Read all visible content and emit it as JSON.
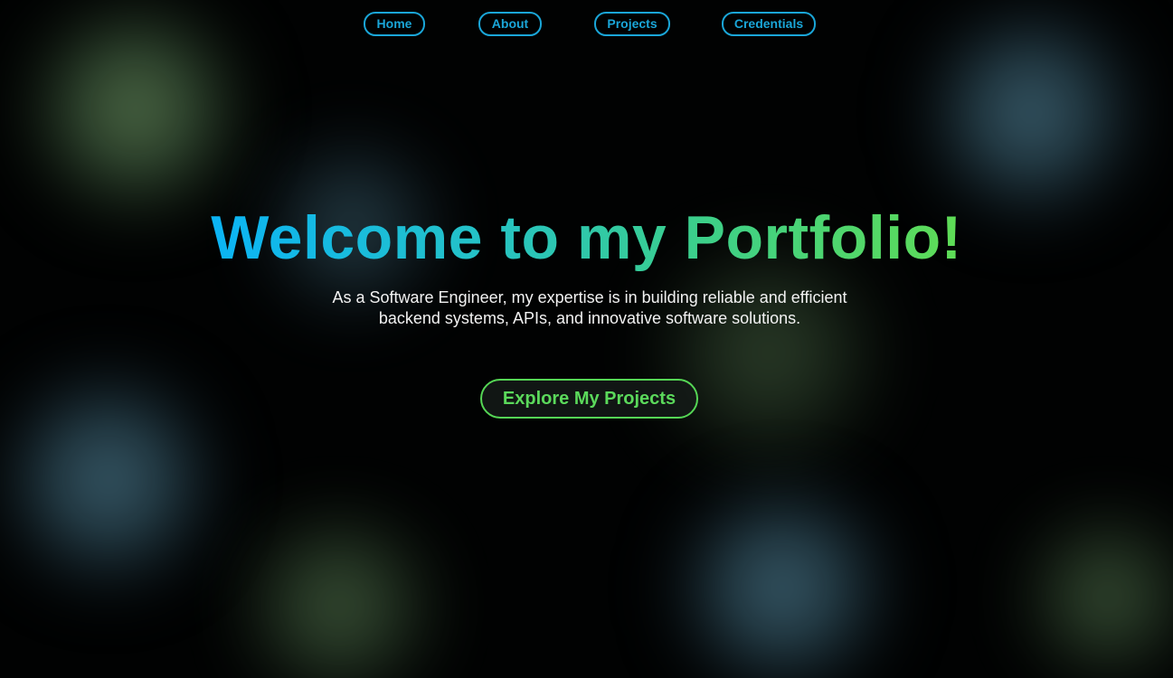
{
  "nav": {
    "items": [
      {
        "label": "Home"
      },
      {
        "label": "About"
      },
      {
        "label": "Projects"
      },
      {
        "label": "Credentials"
      }
    ]
  },
  "hero": {
    "title": "Welcome to my Portfolio!",
    "subtitle_line1": "As a Software Engineer, my expertise is in building reliable and efficient",
    "subtitle_line2": "backend systems, APIs, and innovative software solutions.",
    "cta_label": "Explore My Projects"
  },
  "colors": {
    "accent_blue": "#1aa6d8",
    "accent_green": "#55d655",
    "title_gradient_start": "#0bb4f5",
    "title_gradient_end": "#5fdc55",
    "background": "#010202"
  }
}
